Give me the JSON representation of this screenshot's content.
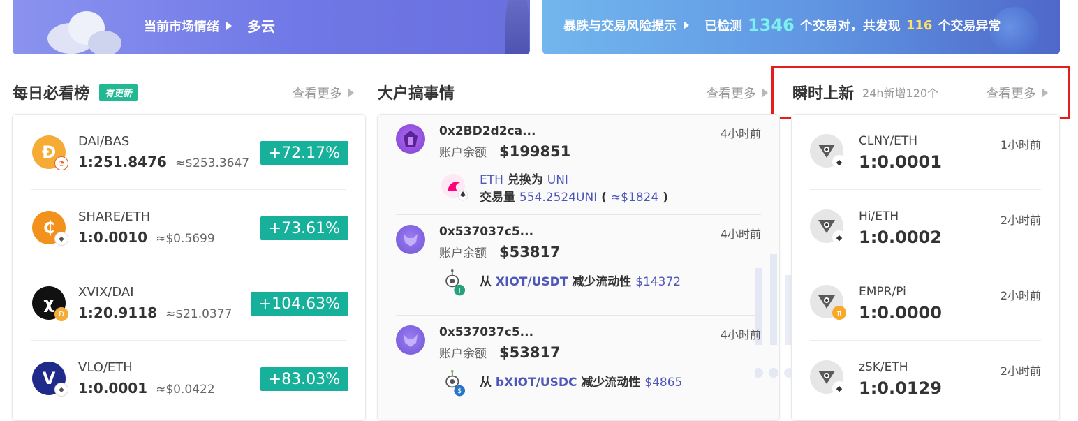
{
  "banner_left": {
    "label": "当前市场情绪",
    "weather": "多云"
  },
  "banner_right": {
    "label": "暴跌与交易风险提示",
    "detected_prefix": "已检测",
    "pairs_count": "1346",
    "pairs_suffix": "个交易对，共发现",
    "anomaly_count": "116",
    "anomaly_suffix": "个交易异常"
  },
  "daily": {
    "title": "每日必看榜",
    "badge": "有更新",
    "more": "查看更多",
    "items": [
      {
        "pair": "DAI/BAS",
        "ratio": "1:251.8476",
        "usd": "≈$253.3647",
        "change": "+72.17%",
        "icon": "dai-coin-icon",
        "color": "#f5ac37"
      },
      {
        "pair": "SHARE/ETH",
        "ratio": "1:0.0010",
        "usd": "≈$0.5699",
        "change": "+73.61%",
        "icon": "share-coin-icon",
        "color": "#f2921c"
      },
      {
        "pair": "XVIX/DAI",
        "ratio": "1:20.9118",
        "usd": "≈$21.0377",
        "change": "+104.63%",
        "icon": "xvix-coin-icon",
        "color": "#111111"
      },
      {
        "pair": "VLO/ETH",
        "ratio": "1:0.0001",
        "usd": "≈$0.0422",
        "change": "+83.03%",
        "icon": "vlo-coin-icon",
        "color": "#1f2a8a"
      }
    ]
  },
  "whale": {
    "title": "大户搞事情",
    "more": "查看更多",
    "balance_label": "账户余额",
    "items": [
      {
        "address": "0x2BD2d2ca...",
        "time": "4小时前",
        "balance": "$199851",
        "line1_a": "ETH",
        "line1_b": " 兑换为 ",
        "line1_c": "UNI",
        "line2_a": "交易量 ",
        "line2_b": "554.2524UNI",
        "line2_c": " ( ",
        "line2_d": "≈$1824",
        "line2_e": " )"
      },
      {
        "address": "0x537037c5...",
        "time": "4小时前",
        "balance": "$53817",
        "act_a": "从 ",
        "act_b": "XIOT/USDT",
        "act_c": " 减少流动性 ",
        "act_d": "$14372"
      },
      {
        "address": "0x537037c5...",
        "time": "4小时前",
        "balance": "$53817",
        "act_a": "从 ",
        "act_b": "bXIOT/USDC",
        "act_c": " 减少流动性 ",
        "act_d": "$4865"
      }
    ]
  },
  "new_listing": {
    "title": "瞬时上新",
    "subtitle": "24h新增120个",
    "more": "查看更多",
    "items": [
      {
        "pair": "CLNY/ETH",
        "ratio": "1:0.0001",
        "time": "1小时前"
      },
      {
        "pair": "Hi/ETH",
        "ratio": "1:0.0002",
        "time": "2小时前"
      },
      {
        "pair": "EMPR/Pi",
        "ratio": "1:0.0000",
        "time": "2小时前"
      },
      {
        "pair": "zSK/ETH",
        "ratio": "1:0.0129",
        "time": "2小时前"
      }
    ]
  },
  "colors": {
    "change_green": "#17b09a",
    "badge_green": "#22b892",
    "highlight_red": "#e41d1d",
    "link_blue": "#4d57b8"
  }
}
